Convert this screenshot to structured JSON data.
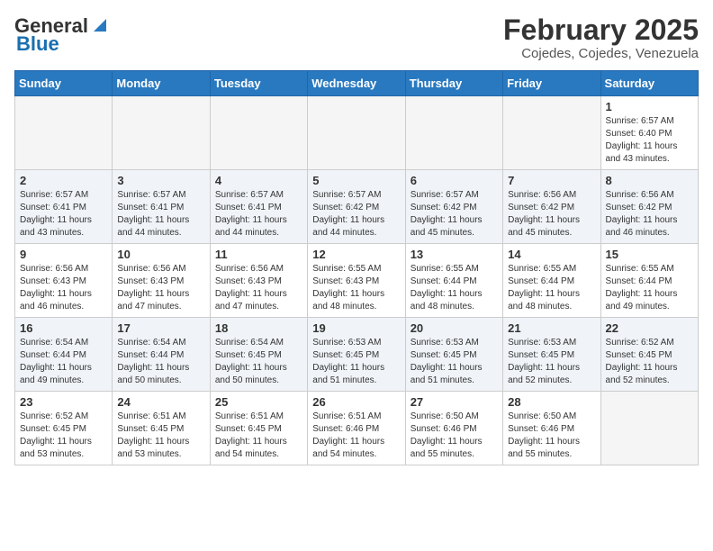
{
  "header": {
    "logo_general": "General",
    "logo_blue": "Blue",
    "title": "February 2025",
    "subtitle": "Cojedes, Cojedes, Venezuela"
  },
  "days_of_week": [
    "Sunday",
    "Monday",
    "Tuesday",
    "Wednesday",
    "Thursday",
    "Friday",
    "Saturday"
  ],
  "weeks": [
    [
      {
        "day": "",
        "info": ""
      },
      {
        "day": "",
        "info": ""
      },
      {
        "day": "",
        "info": ""
      },
      {
        "day": "",
        "info": ""
      },
      {
        "day": "",
        "info": ""
      },
      {
        "day": "",
        "info": ""
      },
      {
        "day": "1",
        "info": "Sunrise: 6:57 AM\nSunset: 6:40 PM\nDaylight: 11 hours\nand 43 minutes."
      }
    ],
    [
      {
        "day": "2",
        "info": "Sunrise: 6:57 AM\nSunset: 6:41 PM\nDaylight: 11 hours\nand 43 minutes."
      },
      {
        "day": "3",
        "info": "Sunrise: 6:57 AM\nSunset: 6:41 PM\nDaylight: 11 hours\nand 44 minutes."
      },
      {
        "day": "4",
        "info": "Sunrise: 6:57 AM\nSunset: 6:41 PM\nDaylight: 11 hours\nand 44 minutes."
      },
      {
        "day": "5",
        "info": "Sunrise: 6:57 AM\nSunset: 6:42 PM\nDaylight: 11 hours\nand 44 minutes."
      },
      {
        "day": "6",
        "info": "Sunrise: 6:57 AM\nSunset: 6:42 PM\nDaylight: 11 hours\nand 45 minutes."
      },
      {
        "day": "7",
        "info": "Sunrise: 6:56 AM\nSunset: 6:42 PM\nDaylight: 11 hours\nand 45 minutes."
      },
      {
        "day": "8",
        "info": "Sunrise: 6:56 AM\nSunset: 6:42 PM\nDaylight: 11 hours\nand 46 minutes."
      }
    ],
    [
      {
        "day": "9",
        "info": "Sunrise: 6:56 AM\nSunset: 6:43 PM\nDaylight: 11 hours\nand 46 minutes."
      },
      {
        "day": "10",
        "info": "Sunrise: 6:56 AM\nSunset: 6:43 PM\nDaylight: 11 hours\nand 47 minutes."
      },
      {
        "day": "11",
        "info": "Sunrise: 6:56 AM\nSunset: 6:43 PM\nDaylight: 11 hours\nand 47 minutes."
      },
      {
        "day": "12",
        "info": "Sunrise: 6:55 AM\nSunset: 6:43 PM\nDaylight: 11 hours\nand 48 minutes."
      },
      {
        "day": "13",
        "info": "Sunrise: 6:55 AM\nSunset: 6:44 PM\nDaylight: 11 hours\nand 48 minutes."
      },
      {
        "day": "14",
        "info": "Sunrise: 6:55 AM\nSunset: 6:44 PM\nDaylight: 11 hours\nand 48 minutes."
      },
      {
        "day": "15",
        "info": "Sunrise: 6:55 AM\nSunset: 6:44 PM\nDaylight: 11 hours\nand 49 minutes."
      }
    ],
    [
      {
        "day": "16",
        "info": "Sunrise: 6:54 AM\nSunset: 6:44 PM\nDaylight: 11 hours\nand 49 minutes."
      },
      {
        "day": "17",
        "info": "Sunrise: 6:54 AM\nSunset: 6:44 PM\nDaylight: 11 hours\nand 50 minutes."
      },
      {
        "day": "18",
        "info": "Sunrise: 6:54 AM\nSunset: 6:45 PM\nDaylight: 11 hours\nand 50 minutes."
      },
      {
        "day": "19",
        "info": "Sunrise: 6:53 AM\nSunset: 6:45 PM\nDaylight: 11 hours\nand 51 minutes."
      },
      {
        "day": "20",
        "info": "Sunrise: 6:53 AM\nSunset: 6:45 PM\nDaylight: 11 hours\nand 51 minutes."
      },
      {
        "day": "21",
        "info": "Sunrise: 6:53 AM\nSunset: 6:45 PM\nDaylight: 11 hours\nand 52 minutes."
      },
      {
        "day": "22",
        "info": "Sunrise: 6:52 AM\nSunset: 6:45 PM\nDaylight: 11 hours\nand 52 minutes."
      }
    ],
    [
      {
        "day": "23",
        "info": "Sunrise: 6:52 AM\nSunset: 6:45 PM\nDaylight: 11 hours\nand 53 minutes."
      },
      {
        "day": "24",
        "info": "Sunrise: 6:51 AM\nSunset: 6:45 PM\nDaylight: 11 hours\nand 53 minutes."
      },
      {
        "day": "25",
        "info": "Sunrise: 6:51 AM\nSunset: 6:45 PM\nDaylight: 11 hours\nand 54 minutes."
      },
      {
        "day": "26",
        "info": "Sunrise: 6:51 AM\nSunset: 6:46 PM\nDaylight: 11 hours\nand 54 minutes."
      },
      {
        "day": "27",
        "info": "Sunrise: 6:50 AM\nSunset: 6:46 PM\nDaylight: 11 hours\nand 55 minutes."
      },
      {
        "day": "28",
        "info": "Sunrise: 6:50 AM\nSunset: 6:46 PM\nDaylight: 11 hours\nand 55 minutes."
      },
      {
        "day": "",
        "info": ""
      }
    ]
  ]
}
